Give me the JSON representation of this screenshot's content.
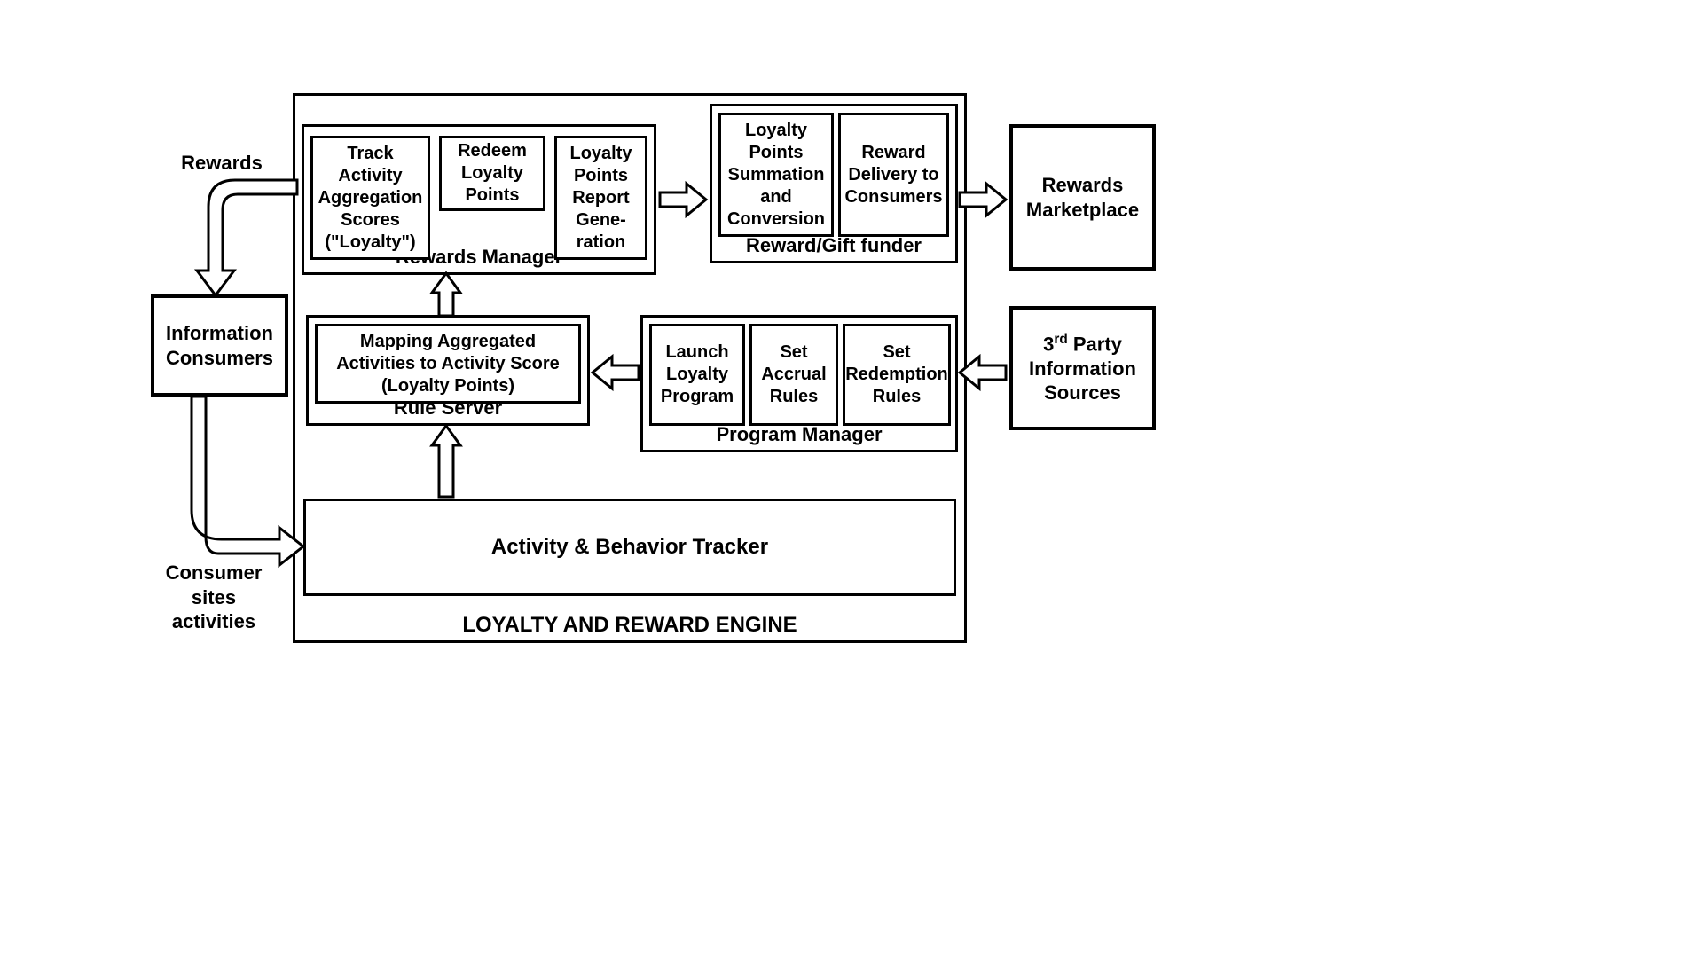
{
  "external": {
    "rewards_label": "Rewards",
    "info_consumers": "Information Consumers",
    "consumer_sites": "Consumer sites activities",
    "rewards_marketplace": "Rewards Marketplace",
    "third_party_sources_prefix": "3",
    "third_party_sources_sup": "rd",
    "third_party_sources_rest": " Party Information Sources"
  },
  "engine": {
    "title": "LOYALTY AND REWARD ENGINE",
    "rewards_manager": {
      "title": "Rewards Manager",
      "track_activity": "Track Activity Aggregation Scores (\"Loyalty\")",
      "redeem": "Redeem Loyalty Points",
      "report_gen": "Loyalty Points Report Gene-ration"
    },
    "reward_funder": {
      "title": "Reward/Gift funder",
      "summation": "Loyalty Points Summation and Conversion",
      "delivery": "Reward Delivery to Consumers"
    },
    "rule_server": {
      "title": "Rule Server",
      "mapping": "Mapping Aggregated Activities to Activity Score (Loyalty Points)"
    },
    "program_manager": {
      "title": "Program Manager",
      "launch": "Launch Loyalty Program",
      "accrual": "Set Accrual Rules",
      "redemption": "Set Redemption Rules"
    },
    "activity_tracker": "Activity & Behavior Tracker"
  }
}
